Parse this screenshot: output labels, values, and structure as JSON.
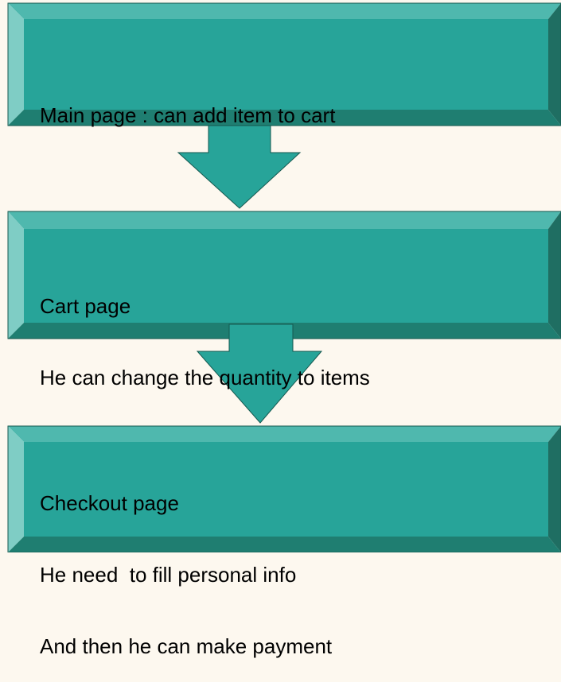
{
  "flowchart": {
    "colors": {
      "background": "#FDF8EF",
      "box_face": "#27A499",
      "bevel_top": "#4FB8AE",
      "bevel_left": "#7FCDC5",
      "bevel_right": "#1F6E62",
      "bevel_bottom": "#1F7E71",
      "outline": "#15584F",
      "text": "#000000"
    },
    "steps": [
      {
        "lines": [
          "Main page : can add item to cart"
        ]
      },
      {
        "lines": [
          "Cart page",
          "He can change the quantity to items"
        ]
      },
      {
        "lines": [
          "Checkout page",
          "He need  to fill personal info",
          "And then he can make payment"
        ]
      }
    ],
    "connectors": [
      {
        "from": 1,
        "to": 2,
        "icon": "down-arrow-icon"
      },
      {
        "from": 2,
        "to": 3,
        "icon": "down-arrow-icon"
      }
    ]
  }
}
